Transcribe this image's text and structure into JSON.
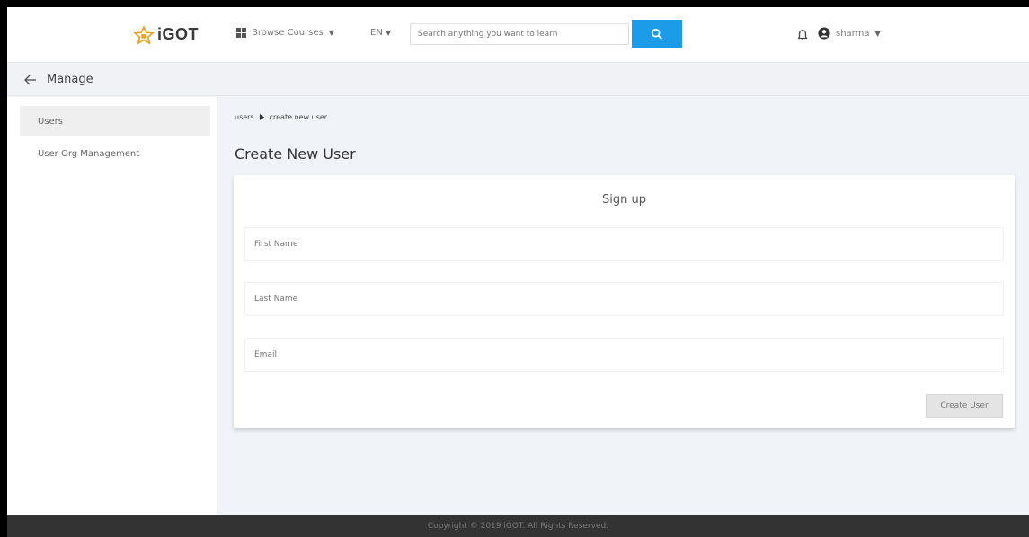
{
  "topbar": {
    "logo_text": "iGOT",
    "browse_label": "Browse Courses",
    "language_label": "EN",
    "search_placeholder": "Search anything you want to learn",
    "user_label": "sharma"
  },
  "managebar": {
    "title": "Manage"
  },
  "sidebar": {
    "items": [
      {
        "label": "Users"
      },
      {
        "label": "User Org Management"
      }
    ]
  },
  "main": {
    "breadcrumb": {
      "parent": "users",
      "current": "create new user"
    },
    "page_title": "Create New User",
    "form": {
      "title": "Sign up",
      "first_name_placeholder": "First Name",
      "last_name_placeholder": "Last Name",
      "email_placeholder": "Email",
      "create_label": "Create User"
    }
  },
  "footer": {
    "text": "Copyright © 2019 iGOT. All Rights Reserved."
  },
  "colors": {
    "accent": "#1c9be8",
    "logo_star": "#f0a020",
    "background": "#f0f4f8",
    "footer": "#333333"
  }
}
